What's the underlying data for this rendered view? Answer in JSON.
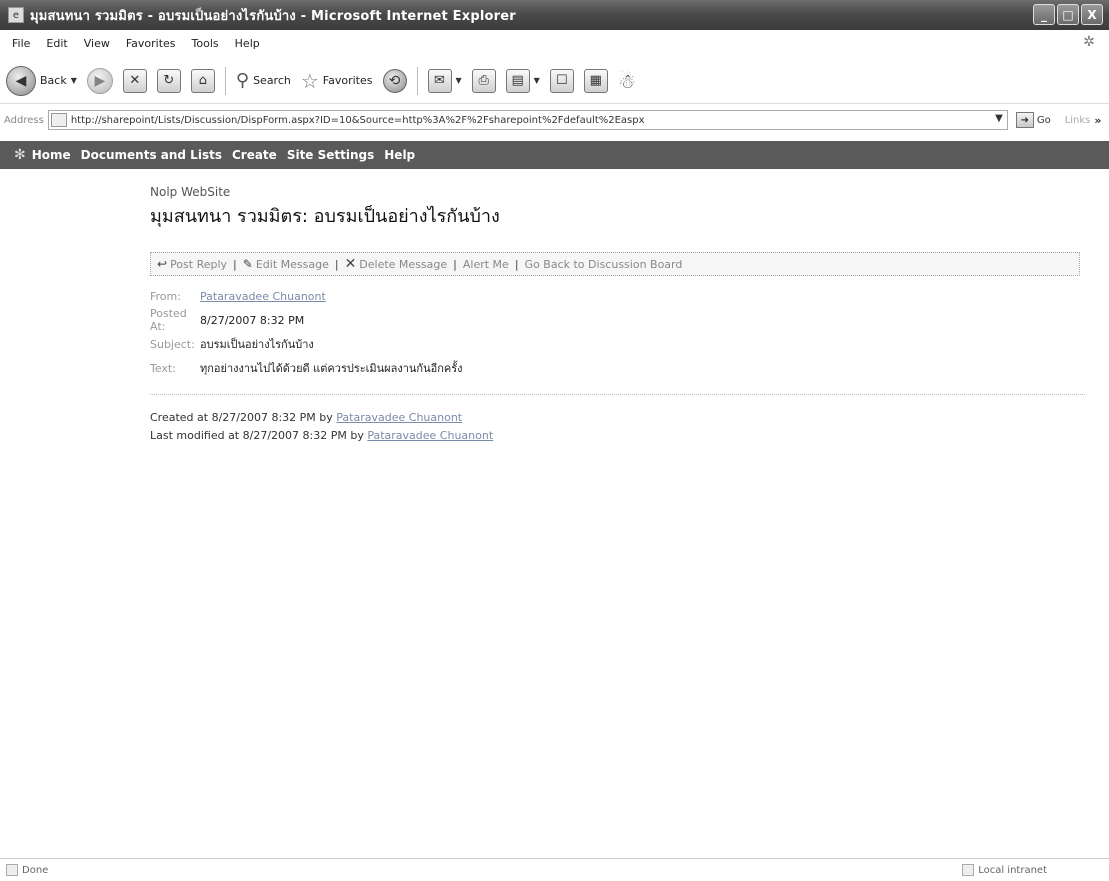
{
  "window": {
    "title": "มุมสนทนา รวมมิตร - อบรมเป็นอย่างไรกันบ้าง - Microsoft Internet Explorer",
    "minimize": "_",
    "maximize": "□",
    "close": "X"
  },
  "menu": [
    "File",
    "Edit",
    "View",
    "Favorites",
    "Tools",
    "Help"
  ],
  "toolbar": {
    "back_label": "Back",
    "search_label": "Search",
    "favorites_label": "Favorites"
  },
  "address": {
    "label": "Address",
    "url": "http://sharepoint/Lists/Discussion/DispForm.aspx?ID=10&Source=http%3A%2F%2Fsharepoint%2Fdefault%2Easpx",
    "go_label": "Go",
    "links_label": "Links",
    "links_more": "»"
  },
  "sp_nav": [
    "Home",
    "Documents and Lists",
    "Create",
    "Site Settings",
    "Help"
  ],
  "site": {
    "name": "Nolp WebSite",
    "title": "มุมสนทนา รวมมิตร: อบรมเป็นอย่างไรกันบ้าง"
  },
  "actions": {
    "post_reply": "Post Reply",
    "edit_message": "Edit Message",
    "delete_message": "Delete Message",
    "alert_me": "Alert Me",
    "go_back": "Go Back to Discussion Board",
    "separator": "|"
  },
  "fields": {
    "from_label": "From:",
    "from_value": "Pataravadee Chuanont",
    "posted_label": "Posted At:",
    "posted_value": "8/27/2007 8:32 PM",
    "subject_label": "Subject:",
    "subject_value": "อบรมเป็นอย่างไรกันบ้าง",
    "text_label": "Text:",
    "text_value": "ทุกอย่างงานไปได้ด้วยดี แต่ควรประเมินผลงานกันอีกครั้ง"
  },
  "meta": {
    "created_prefix": "Created at 8/27/2007 8:32 PM by",
    "created_by": "Pataravadee Chuanont",
    "modified_prefix": "Last modified at 8/27/2007 8:32 PM by",
    "modified_by": "Pataravadee Chuanont"
  },
  "status": {
    "left": "Done",
    "zone": "Local intranet"
  }
}
